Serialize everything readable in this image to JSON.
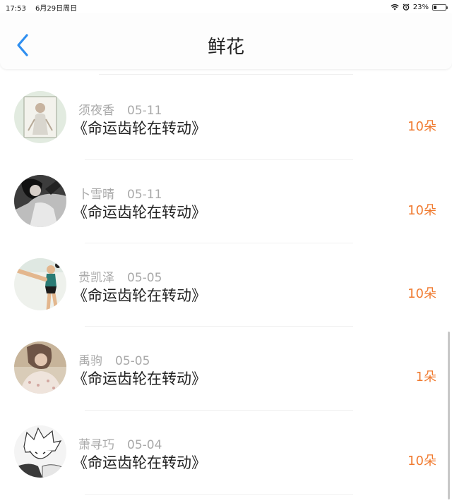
{
  "status": {
    "time": "17:53",
    "date": "6月29日周日",
    "battery_text": "23%",
    "battery_level": 0.23
  },
  "header": {
    "title": "鲜花"
  },
  "rows": [
    {
      "name": "须夜香",
      "date": "05-11",
      "book": "《命运齿轮在转动》",
      "flowers": "10朵"
    },
    {
      "name": "卜雪晴",
      "date": "05-11",
      "book": "《命运齿轮在转动》",
      "flowers": "10朵"
    },
    {
      "name": "贵凯泽",
      "date": "05-05",
      "book": "《命运齿轮在转动》",
      "flowers": "10朵"
    },
    {
      "name": "禹驹",
      "date": "05-05",
      "book": "《命运齿轮在转动》",
      "flowers": "1朵"
    },
    {
      "name": "萧寻巧",
      "date": "05-04",
      "book": "《命运齿轮在转动》",
      "flowers": "10朵"
    }
  ],
  "colors": {
    "accent_blue": "#2f8ff0",
    "flower_orange": "#f07a2f"
  }
}
